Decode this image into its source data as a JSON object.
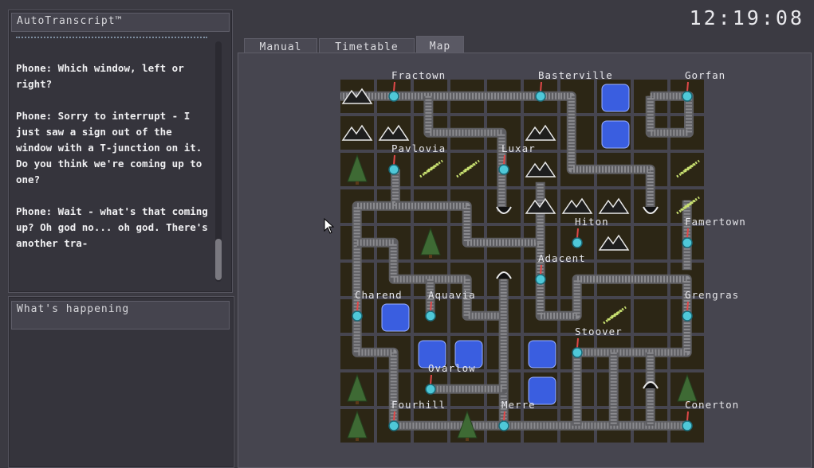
{
  "clock": "12:19:08",
  "transcript": {
    "title": "AutoTranscript™",
    "lines": [
      "Phone: Which window, left or right?",
      "Phone: Sorry to interrupt - I just saw a sign out of the window with a T-junction on it. Do you think we're coming up to one?",
      "Phone: Wait - what's that coming up? Oh god no... oh god. There's another tra-"
    ]
  },
  "happening": {
    "title": "What's happening"
  },
  "tabs": [
    "Manual",
    "Timetable",
    "Map"
  ],
  "active_tab": "Map",
  "map": {
    "stations": [
      "Fractown",
      "Basterville",
      "Gorfan",
      "Pavlovia",
      "Luxar",
      "Hiton",
      "Famertown",
      "Adacent",
      "Charend",
      "Aquavia",
      "Grengras",
      "Stoover",
      "Ovarlow",
      "Fourhill",
      "Merre",
      "Conerton"
    ]
  },
  "colors": {
    "background": "#3b3a42",
    "tile": "#2c2615",
    "track": "#8a8a8e",
    "station": "#4fc8d8",
    "water": "#3a5ee0"
  }
}
